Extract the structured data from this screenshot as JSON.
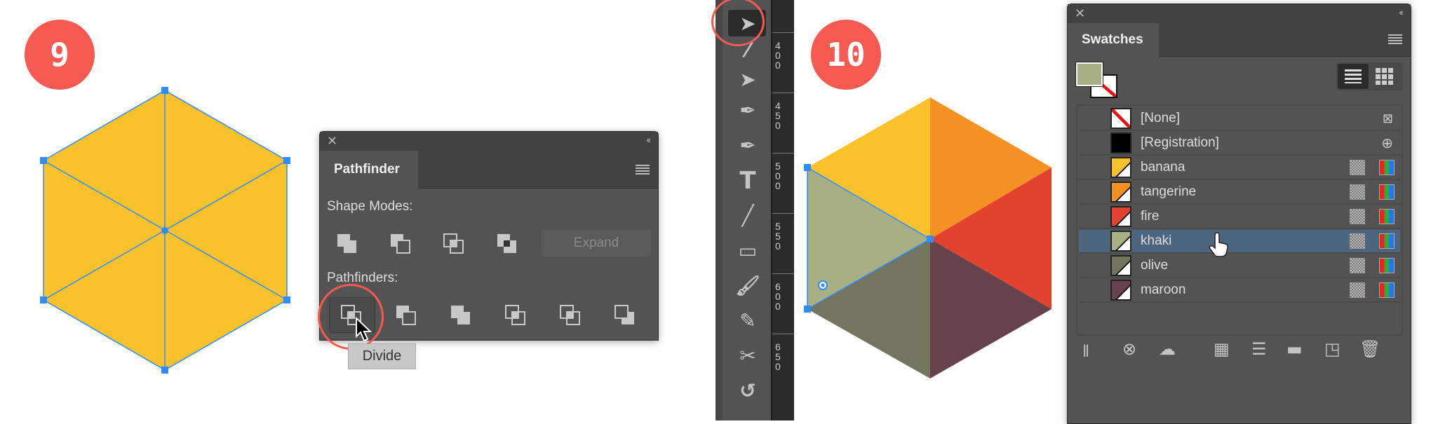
{
  "steps": {
    "left": "9",
    "right": "10"
  },
  "colors": {
    "banana": "#F9C12A",
    "tangerine": "#F39222",
    "fire": "#E3432E",
    "khaki": "#A8AF82",
    "olive": "#737560",
    "maroon": "#66434B",
    "selection": "#2F8CFF",
    "highlight": "#F55A50"
  },
  "pathfinder": {
    "title": "Pathfinder",
    "shape_modes_label": "Shape Modes:",
    "expand_label": "Expand",
    "pathfinders_label": "Pathfinders:",
    "tooltip": "Divide"
  },
  "ruler": {
    "labels": [
      "400",
      "450",
      "500",
      "550",
      "600",
      "650"
    ]
  },
  "toolbar": {
    "tools": [
      "selection-tool",
      "magic-wand-tool",
      "lasso-tool",
      "pen-tool",
      "curvature-tool",
      "type-tool",
      "line-tool",
      "rectangle-tool",
      "paintbrush-tool",
      "shaper-tool",
      "scissors-tool",
      "rotate-tool"
    ],
    "selected": "selection-tool"
  },
  "swatches": {
    "title": "Swatches",
    "fill_color": "#A8AF82",
    "items": [
      {
        "name": "[None]",
        "color": "none"
      },
      {
        "name": "[Registration]",
        "color": "#000000"
      },
      {
        "name": "banana",
        "color": "#F9C12A"
      },
      {
        "name": "tangerine",
        "color": "#F39222"
      },
      {
        "name": "fire",
        "color": "#E3432E"
      },
      {
        "name": "khaki",
        "color": "#A8AF82",
        "selected": true
      },
      {
        "name": "olive",
        "color": "#737560"
      },
      {
        "name": "maroon",
        "color": "#66434B"
      }
    ]
  }
}
